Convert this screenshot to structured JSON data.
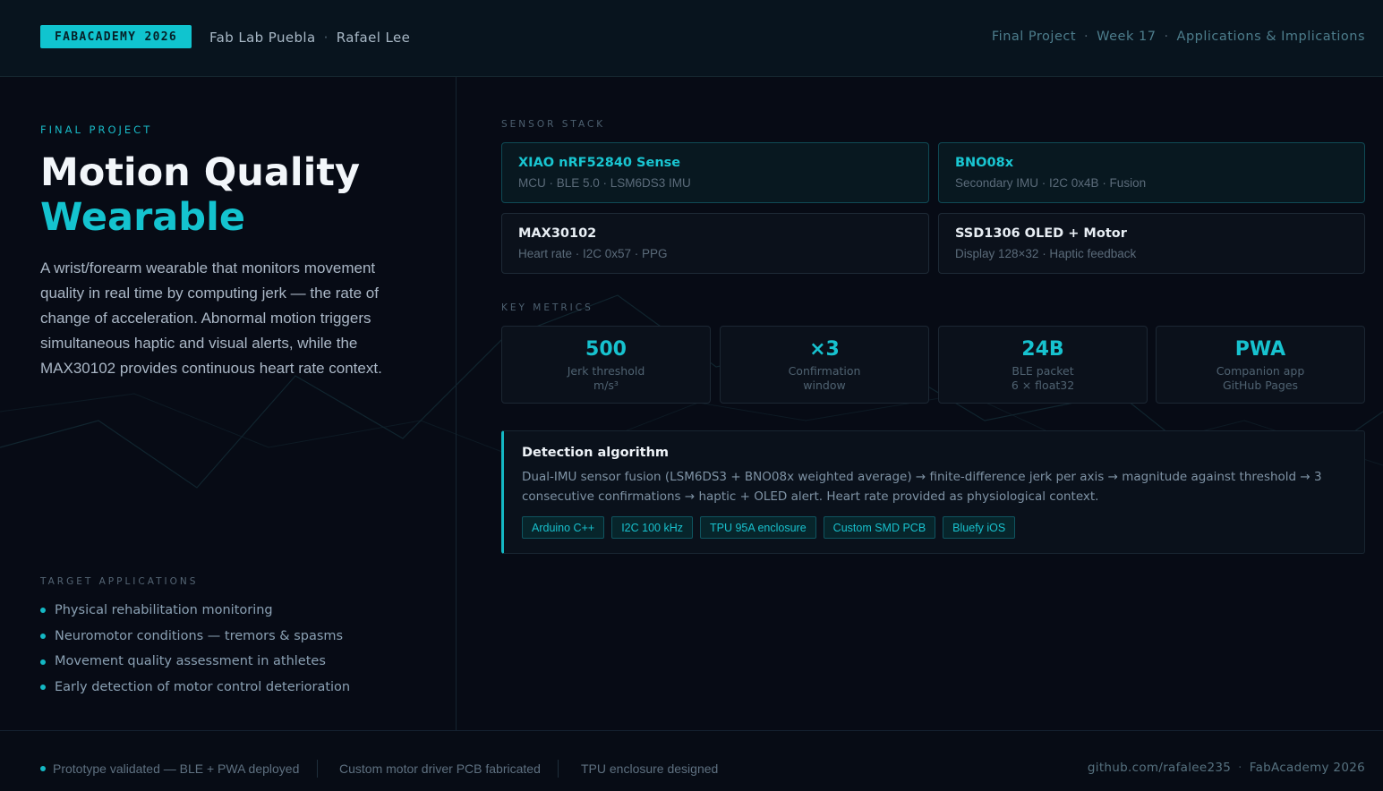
{
  "header": {
    "badge": "FABACADEMY 2026",
    "lab": "Fab Lab Puebla",
    "author": "Rafael Lee",
    "breadcrumb": [
      "Final Project",
      "Week 17",
      "Applications & Implications"
    ]
  },
  "hero": {
    "kicker": "FINAL PROJECT",
    "title_line1": "Motion Quality",
    "title_line2": "Wearable",
    "description": "A wrist/forearm wearable that monitors movement quality in real time by computing jerk — the rate of change of acceleration. Abnormal motion triggers simultaneous haptic and visual alerts, while the MAX30102 provides continuous heart rate context."
  },
  "applications": {
    "label": "TARGET APPLICATIONS",
    "items": [
      "Physical rehabilitation monitoring",
      "Neuromotor conditions — tremors & spasms",
      "Movement quality assessment in athletes",
      "Early detection of motor control deterioration"
    ]
  },
  "sensor_stack": {
    "label": "SENSOR STACK",
    "cards": [
      {
        "name": "XIAO nRF52840 Sense",
        "sub": "MCU · BLE 5.0 · LSM6DS3 IMU",
        "highlight": true
      },
      {
        "name": "BNO08x",
        "sub": "Secondary IMU · I2C 0x4B · Fusion",
        "highlight": true
      },
      {
        "name": "MAX30102",
        "sub": "Heart rate · I2C 0x57 · PPG",
        "highlight": false
      },
      {
        "name": "SSD1306 OLED + Motor",
        "sub": "Display 128×32 · Haptic feedback",
        "highlight": false
      }
    ]
  },
  "key_metrics": {
    "label": "KEY METRICS",
    "items": [
      {
        "value": "500",
        "label": "Jerk threshold",
        "label2": "m/s³"
      },
      {
        "value": "×3",
        "label": "Confirmation",
        "label2": "window"
      },
      {
        "value": "24B",
        "label": "BLE packet",
        "label2": "6 × float32"
      },
      {
        "value": "PWA",
        "label": "Companion app",
        "label2": "GitHub Pages"
      }
    ]
  },
  "algorithm": {
    "title": "Detection algorithm",
    "text": "Dual-IMU sensor fusion (LSM6DS3 + BNO08x weighted average) → finite-difference jerk per axis → magnitude against threshold → 3 consecutive confirmations → haptic + OLED alert. Heart rate provided as physiological context.",
    "tags": [
      "Arduino C++",
      "I2C 100 kHz",
      "TPU 95A enclosure",
      "Custom SMD PCB",
      "Bluefy iOS"
    ]
  },
  "footer": {
    "status": [
      "Prototype validated — BLE + PWA deployed",
      "Custom motor driver PCB fabricated",
      "TPU enclosure designed"
    ],
    "repo": "github.com/rafalee235",
    "program": "FabAcademy 2026"
  },
  "colors": {
    "accent": "#14c3cf",
    "background": "#070b15",
    "header_bg": "#08141e"
  }
}
